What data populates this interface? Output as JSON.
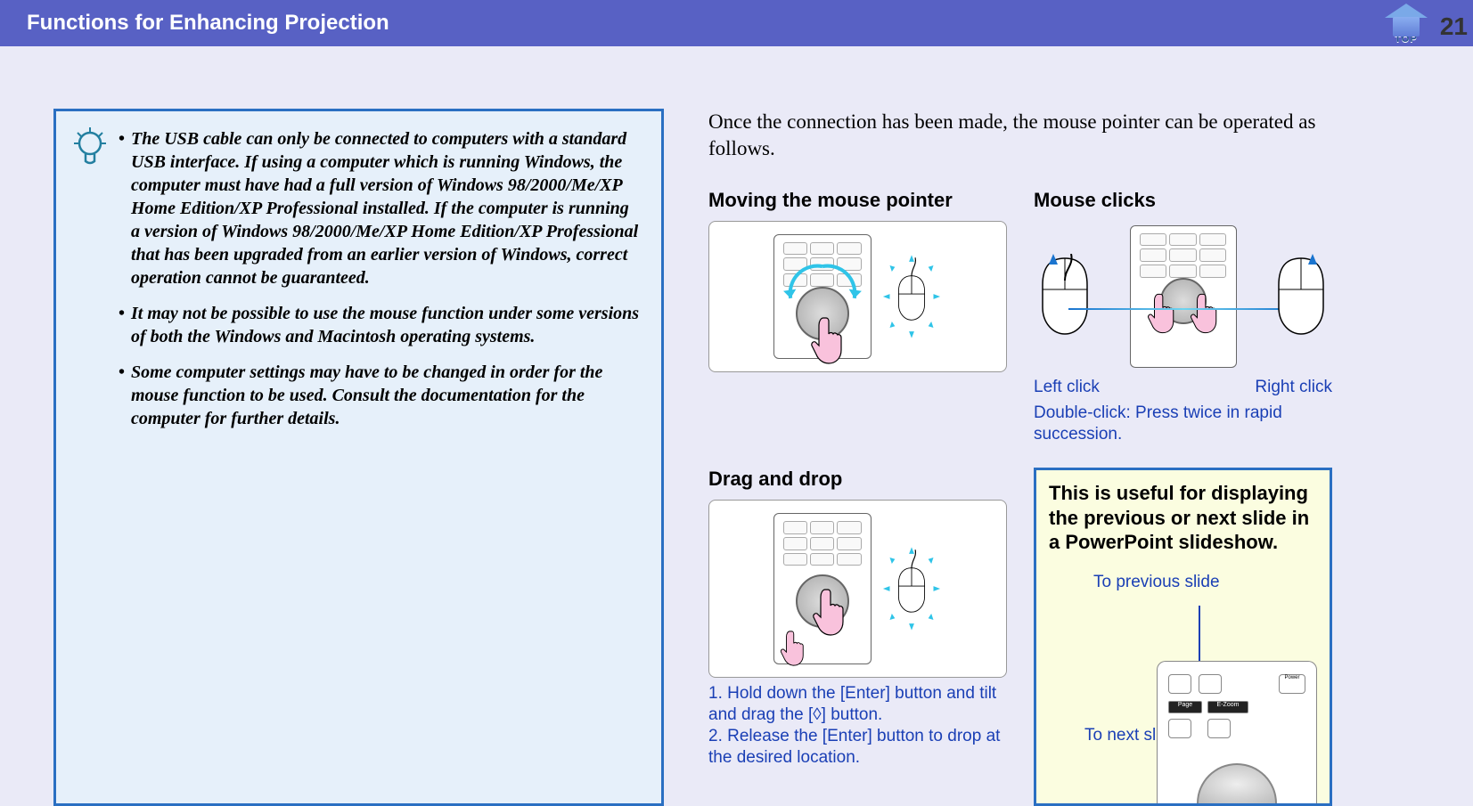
{
  "header": {
    "title": "Functions for Enhancing Projection"
  },
  "page_number": "21",
  "top_button": {
    "label": "TOP"
  },
  "tip_items": [
    "The USB cable can only be connected to computers with a standard USB interface. If using a computer which is running Windows, the computer must have had a full version of Windows 98/2000/Me/XP Home Edition/XP Professional installed. If the computer is running a version of Windows 98/2000/Me/XP Home Edition/XP Professional that has been upgraded from an earlier version of Windows, correct operation cannot be guaranteed.",
    "It may not be possible to use the mouse function under some versions of both the Windows and Macintosh operating systems.",
    "Some computer settings may have to be changed in order for the mouse function to be used. Consult the documentation for the computer for further details."
  ],
  "intro": "Once the connection has been made, the mouse pointer can be operated as follows.",
  "sections": {
    "move": {
      "title": "Moving the mouse pointer"
    },
    "clicks": {
      "title": "Mouse clicks",
      "left": "Left click",
      "right": "Right click",
      "double": "Double-click: Press twice in rapid succession."
    },
    "drag": {
      "title": "Drag and drop",
      "steps": "1. Hold down the [Enter] button and tilt and drag the [◊] button.\n2. Release the [Enter] button to drop at the desired location."
    },
    "ppt": {
      "heading": "This is useful for displaying the previous or next slide in a PowerPoint slideshow.",
      "prev": "To previous slide",
      "next": "To next slide"
    }
  }
}
